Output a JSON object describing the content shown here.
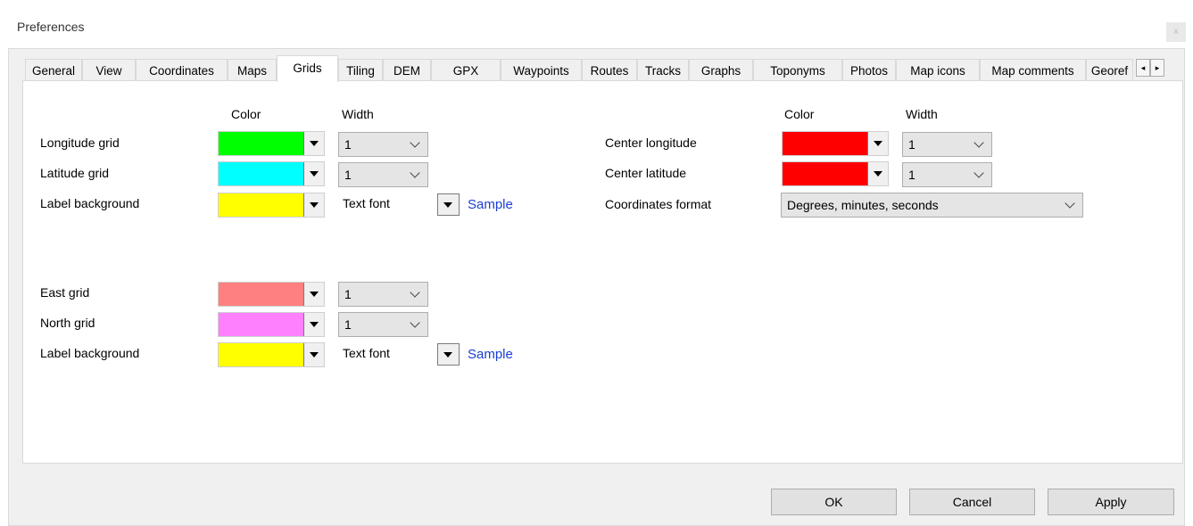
{
  "window": {
    "title": "Preferences",
    "close_label": "x"
  },
  "tabs": [
    "General",
    "View",
    "Coordinates",
    "Maps",
    "Grids",
    "Tiling",
    "DEM",
    "GPX",
    "Waypoints",
    "Routes",
    "Tracks",
    "Graphs",
    "Toponyms",
    "Photos",
    "Map icons",
    "Map comments",
    "Georef"
  ],
  "active_tab": "Grids",
  "tab_scroll": {
    "left": "◂",
    "right": "▸"
  },
  "geo_section": {
    "color_header": "Color",
    "width_header": "Width",
    "rows": [
      {
        "label": "Longitude grid",
        "color": "#00ff00",
        "width": "1"
      },
      {
        "label": "Latitude grid",
        "color": "#00ffff",
        "width": "1"
      }
    ],
    "label_background": {
      "label": "Label background",
      "color": "#ffff00"
    },
    "text_font_label": "Text font",
    "sample_label": "Sample"
  },
  "center_section": {
    "color_header": "Color",
    "width_header": "Width",
    "rows": [
      {
        "label": "Center longitude",
        "color": "#ff0000",
        "width": "1"
      },
      {
        "label": "Center latitude",
        "color": "#ff0000",
        "width": "1"
      }
    ],
    "coordinates_format": {
      "label": "Coordinates format",
      "value": "Degrees, minutes, seconds"
    }
  },
  "utm_section": {
    "rows": [
      {
        "label": "East grid",
        "color": "#ff8080",
        "width": "1"
      },
      {
        "label": "North grid",
        "color": "#ff80ff",
        "width": "1"
      }
    ],
    "label_background": {
      "label": "Label background",
      "color": "#ffff00"
    },
    "text_font_label": "Text font",
    "sample_label": "Sample"
  },
  "buttons": {
    "ok": "OK",
    "cancel": "Cancel",
    "apply": "Apply"
  }
}
